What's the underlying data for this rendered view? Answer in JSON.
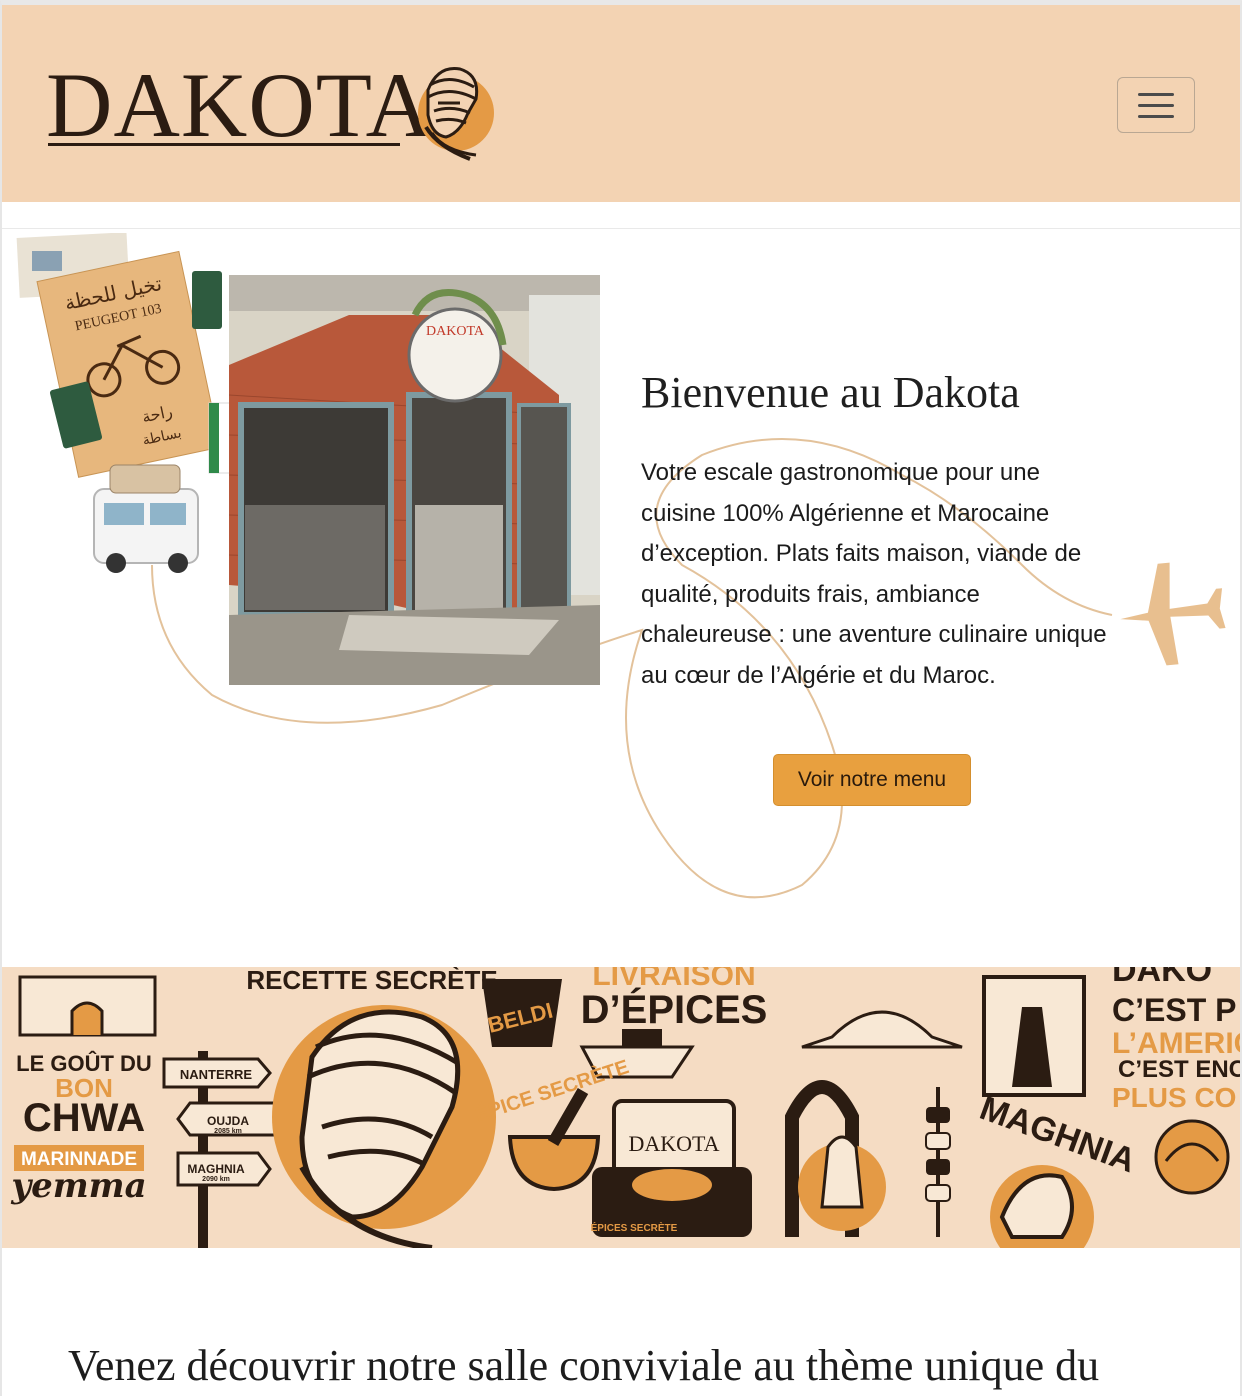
{
  "header": {
    "logo_text": "DAKOTA",
    "menu_toggle_icon": "hamburger-icon"
  },
  "hero": {
    "title": "Bienvenue au Dakota",
    "description": "Votre escale gastronomique pour une cuisine 100% Algérienne et Marocaine d’exception. Plats faits maison, viande de qualité, produits frais, ambiance chaleureuse : une aventure culinaire unique au cœur de l’Algérie et du Maroc.",
    "cta_label": "Voir notre menu",
    "store_sign": "DAKOTA",
    "collage_poster_text": "PEUGEOT 103"
  },
  "banner": {
    "secret_recipe": "RECETTE SECRÈTE",
    "spice_delivery_top": "LIVRAISON",
    "spice_delivery": "D’ÉPICES",
    "beldi": "BELDI",
    "gout_line1": "LE GOÛT DU",
    "gout_line2": "BON",
    "gout_line3": "CHWA",
    "marinnade": "MARINNADE",
    "yemma": "yemma",
    "sign_1": "NANTERRE",
    "sign_2": "OUJDA",
    "sign_2_km": "2085 km",
    "sign_3": "MAGHNIA",
    "sign_3_km": "2090 km",
    "epice_secrete": "ÉPICE SECRÈTE",
    "suitcase_brand": "DAKOTA",
    "suitcase_tag": "ÉPICES SECRÈTE",
    "maghnia_big": "MAGHNIA",
    "dakota_corner": "DAKO",
    "cest_p": "C’EST P",
    "lameri": "L’AMERIC",
    "cest_enc": "C’EST ENC",
    "plus_co": "PLUS CO"
  },
  "section": {
    "heading": "Venez découvrir notre salle conviviale au thème unique du"
  },
  "colors": {
    "header_bg": "#f3d3b3",
    "accent": "#e8a03f",
    "dark": "#2b1c12",
    "banner_bg": "#f5dcc3",
    "route": "#e3c29b"
  }
}
